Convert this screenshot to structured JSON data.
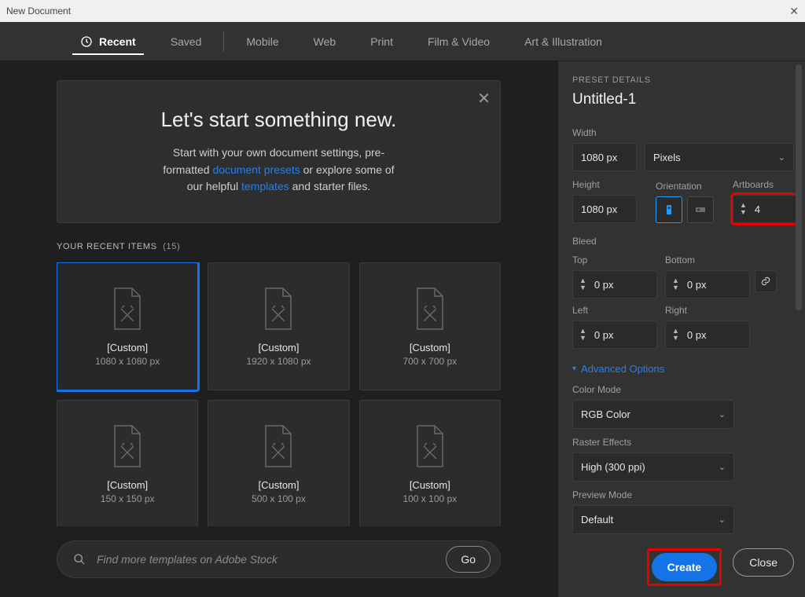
{
  "window_title": "New Document",
  "tabs": [
    "Recent",
    "Saved",
    "Mobile",
    "Web",
    "Print",
    "Film & Video",
    "Art & Illustration"
  ],
  "active_tab": "Recent",
  "hero": {
    "title": "Let's start something new.",
    "line1a": "Start with your own document settings, pre-",
    "line1b": "formatted ",
    "link1": "document presets",
    "line1c": " or explore some of",
    "line2a": "our helpful ",
    "link2": "templates",
    "line2b": " and starter files."
  },
  "recent": {
    "label": "YOUR RECENT ITEMS",
    "count": "(15)",
    "items": [
      {
        "name": "[Custom]",
        "dims": "1080 x 1080 px"
      },
      {
        "name": "[Custom]",
        "dims": "1920 x 1080 px"
      },
      {
        "name": "[Custom]",
        "dims": "700 x 700 px"
      },
      {
        "name": "[Custom]",
        "dims": "150 x 150 px"
      },
      {
        "name": "[Custom]",
        "dims": "500 x 100 px"
      },
      {
        "name": "[Custom]",
        "dims": "100 x 100 px"
      }
    ]
  },
  "search": {
    "placeholder": "Find more templates on Adobe Stock",
    "go": "Go"
  },
  "preset": {
    "section": "PRESET DETAILS",
    "name": "Untitled-1",
    "width_label": "Width",
    "width": "1080 px",
    "units": "Pixels",
    "height_label": "Height",
    "height": "1080 px",
    "orient_label": "Orientation",
    "artboards_label": "Artboards",
    "artboards": "4",
    "bleed_label": "Bleed",
    "top_label": "Top",
    "bottom_label": "Bottom",
    "left_label": "Left",
    "right_label": "Right",
    "top": "0 px",
    "bottom": "0 px",
    "left": "0 px",
    "right": "0 px",
    "adv": "Advanced Options",
    "colormode_label": "Color Mode",
    "colormode": "RGB Color",
    "raster_label": "Raster Effects",
    "raster": "High (300 ppi)",
    "preview_label": "Preview Mode",
    "preview": "Default"
  },
  "buttons": {
    "create": "Create",
    "close": "Close"
  }
}
